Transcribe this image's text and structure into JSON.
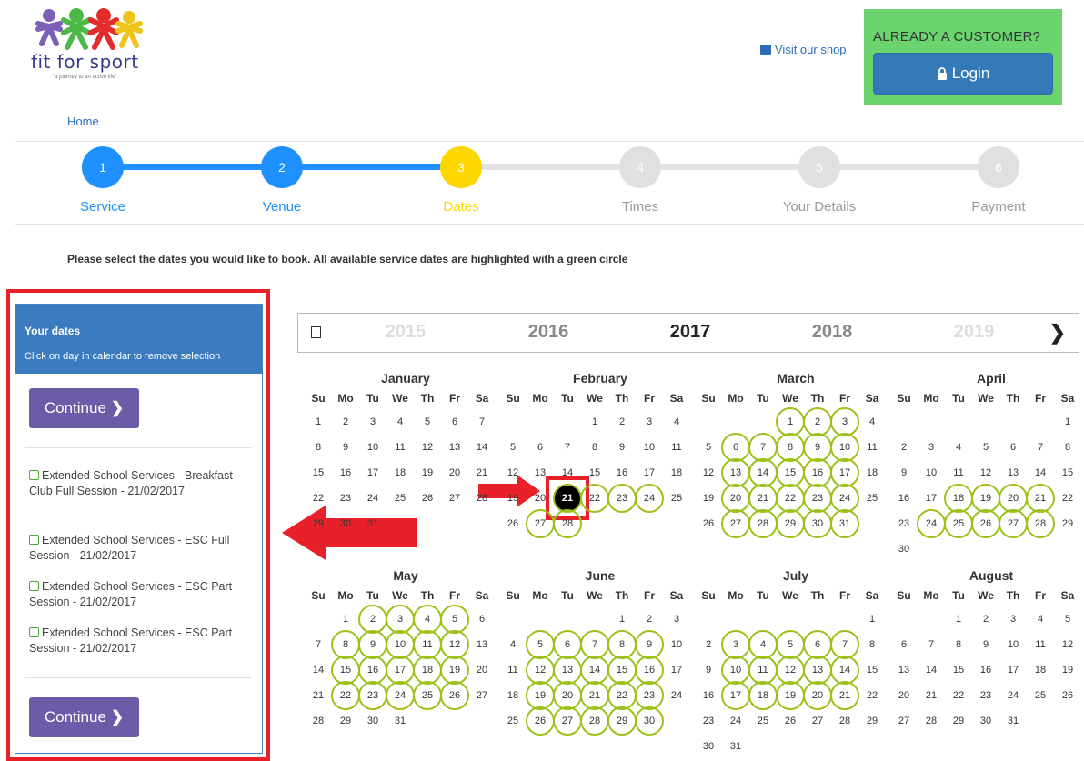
{
  "brand": {
    "name": "fit for sport",
    "tagline": "\"a journey to an active life\""
  },
  "header": {
    "shop_link": "Visit our shop",
    "customer_title": "ALREADY A CUSTOMER?",
    "login_label": "Login",
    "breadcrumb_home": "Home"
  },
  "steps": [
    {
      "num": "1",
      "label": "Service",
      "state": "done"
    },
    {
      "num": "2",
      "label": "Venue",
      "state": "done"
    },
    {
      "num": "3",
      "label": "Dates",
      "state": "current"
    },
    {
      "num": "4",
      "label": "Times",
      "state": "todo"
    },
    {
      "num": "5",
      "label": "Your Details",
      "state": "todo"
    },
    {
      "num": "6",
      "label": "Payment",
      "state": "todo"
    }
  ],
  "instruction": "Please select the dates you would like to book.  All available service dates are highlighted with a green circle",
  "panel": {
    "title": "Your dates",
    "subtitle": "Click on day in calendar to remove selection",
    "continue_label": "Continue",
    "selections": [
      "Extended School Services - Breakfast Club Full Session - 21/02/2017",
      "Extended School Services - ESC Full Session - 21/02/2017",
      "Extended School Services - ESC Part Session - 21/02/2017",
      "Extended School Services - ESC Part Session - 21/02/2017"
    ]
  },
  "calendar": {
    "years": [
      "2015",
      "2016",
      "2017",
      "2018",
      "2019"
    ],
    "current_year": "2017",
    "prev_icon": "square-icon",
    "next_icon": "chevron-right-icon",
    "weekdays": [
      "Su",
      "Mo",
      "Tu",
      "We",
      "Th",
      "Fr",
      "Sa"
    ],
    "selected_day": {
      "month": "February",
      "day": 21
    },
    "months": [
      {
        "name": "January",
        "start": 0,
        "days": 31,
        "available": []
      },
      {
        "name": "February",
        "start": 3,
        "days": 28,
        "available": [
          21,
          22,
          23,
          24,
          27,
          28
        ]
      },
      {
        "name": "March",
        "start": 3,
        "days": 31,
        "available": [
          1,
          2,
          3,
          6,
          7,
          8,
          9,
          10,
          13,
          14,
          15,
          16,
          17,
          20,
          21,
          22,
          23,
          24,
          27,
          28,
          29,
          30,
          31
        ]
      },
      {
        "name": "April",
        "start": 6,
        "days": 30,
        "available": [
          18,
          19,
          20,
          21,
          24,
          25,
          26,
          27,
          28
        ]
      },
      {
        "name": "May",
        "start": 1,
        "days": 31,
        "available": [
          2,
          3,
          4,
          5,
          8,
          9,
          10,
          11,
          12,
          15,
          16,
          17,
          18,
          19,
          22,
          23,
          24,
          25,
          26
        ]
      },
      {
        "name": "June",
        "start": 4,
        "days": 30,
        "available": [
          5,
          6,
          7,
          8,
          9,
          12,
          13,
          14,
          15,
          16,
          19,
          20,
          21,
          22,
          23,
          26,
          27,
          28,
          29,
          30
        ]
      },
      {
        "name": "July",
        "start": 6,
        "days": 31,
        "available": [
          3,
          4,
          5,
          6,
          7,
          10,
          11,
          12,
          13,
          14,
          17,
          18,
          19,
          20,
          21
        ]
      },
      {
        "name": "August",
        "start": 2,
        "days": 31,
        "available": []
      }
    ]
  },
  "colors": {
    "primary": "#1e90ff",
    "current_step": "#ffd700",
    "available": "#9dc11a",
    "highlight": "#e8202a",
    "continue": "#6c5ba6"
  }
}
